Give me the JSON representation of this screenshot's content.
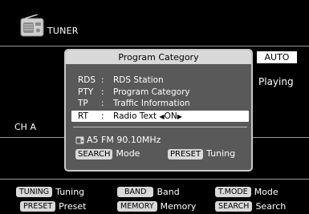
{
  "header": {
    "title": "TUNER",
    "icon": "radio-icon"
  },
  "status": {
    "mode_badge": "AUTO",
    "playback": "Playing",
    "channel": "CH A"
  },
  "dialog": {
    "title": "Program Category",
    "items": [
      {
        "code": "RDS",
        "sep": ":",
        "desc": "RDS Station"
      },
      {
        "code": "PTY",
        "sep": ":",
        "desc": "Program Category"
      },
      {
        "code": "TP",
        "sep": ":",
        "desc": "Traffic Information"
      },
      {
        "code": "RT",
        "sep": ":",
        "desc": "Radio Text",
        "value": "ON",
        "left_arrow": "◀",
        "right_arrow": "▶"
      }
    ],
    "station": "A5 FM 90.10MHz",
    "hints": {
      "left_key": "SEARCH",
      "left_text": "Mode",
      "right_key": "PRESET",
      "right_text": "Tuning"
    }
  },
  "legend": [
    {
      "key": "TUNING",
      "text": "Tuning"
    },
    {
      "key": "BAND",
      "text": "Band"
    },
    {
      "key": "T.MODE",
      "text": "Mode"
    },
    {
      "key": "PRESET",
      "text": "Preset"
    },
    {
      "key": "MEMORY",
      "text": "Memory"
    },
    {
      "key": "SEARCH",
      "text": "Search"
    }
  ],
  "colors": {
    "dialog_bg": "#595959",
    "title_bar": "#d9d9d9",
    "key_bg": "#d9d9d9",
    "selected_row": "#ffffff"
  }
}
